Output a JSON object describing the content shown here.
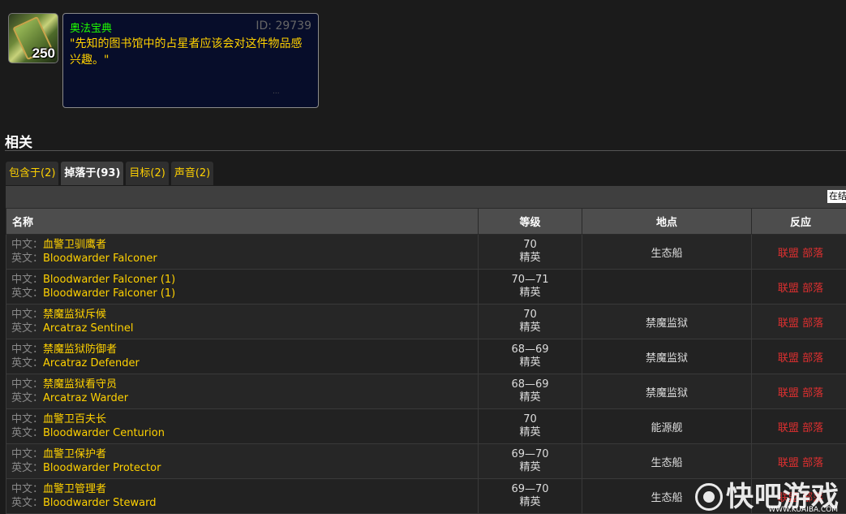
{
  "item": {
    "count": "250",
    "name": "奥法宝典",
    "id_label": "ID: 29739",
    "description": "\"先知的图书馆中的占星者应该会对这件物品感兴趣。\"",
    "dots": "..."
  },
  "related": {
    "title": "相关"
  },
  "tabs": [
    {
      "label": "包含于(2)",
      "active": false
    },
    {
      "label": "掉落于(93)",
      "active": true
    },
    {
      "label": "目标(2)",
      "active": false
    },
    {
      "label": "声音(2)",
      "active": false
    }
  ],
  "search": {
    "value": "在结"
  },
  "table": {
    "headers": {
      "name": "名称",
      "level": "等级",
      "zone": "地点",
      "react": "反应"
    },
    "label_cn": "中文：",
    "label_en": "英文：",
    "react_alliance": "联盟",
    "react_horde": "部落",
    "rows": [
      {
        "cn": "血警卫驯鹰者",
        "en": "Bloodwarder Falconer",
        "level": "70",
        "cls": "精英",
        "zone": "生态船"
      },
      {
        "cn": "Bloodwarder Falconer (1)",
        "en": "Bloodwarder Falconer (1)",
        "level": "70—71",
        "cls": "精英",
        "zone": ""
      },
      {
        "cn": "禁魔监狱斥候",
        "en": "Arcatraz Sentinel",
        "level": "70",
        "cls": "精英",
        "zone": "禁魔监狱"
      },
      {
        "cn": "禁魔监狱防御者",
        "en": "Arcatraz Defender",
        "level": "68—69",
        "cls": "精英",
        "zone": "禁魔监狱"
      },
      {
        "cn": "禁魔监狱看守员",
        "en": "Arcatraz Warder",
        "level": "68—69",
        "cls": "精英",
        "zone": "禁魔监狱"
      },
      {
        "cn": "血警卫百夫长",
        "en": "Bloodwarder Centurion",
        "level": "70",
        "cls": "精英",
        "zone": "能源舰"
      },
      {
        "cn": "血警卫保护者",
        "en": "Bloodwarder Protector",
        "level": "69—70",
        "cls": "精英",
        "zone": "生态船"
      },
      {
        "cn": "血警卫管理者",
        "en": "Bloodwarder Steward",
        "level": "69—70",
        "cls": "精英",
        "zone": "生态船"
      }
    ]
  },
  "watermark": {
    "text": "快吧游戏",
    "sub": "WWW.KUAIBA.COM"
  }
}
